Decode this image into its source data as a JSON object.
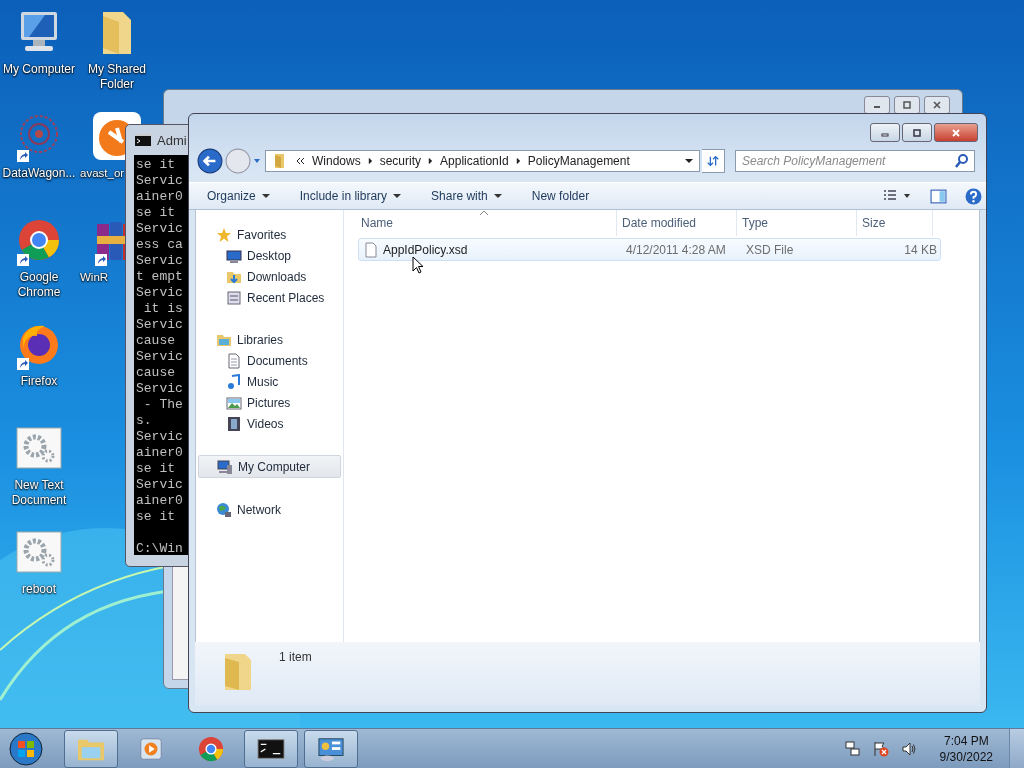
{
  "desktop": {
    "columns": [
      [
        {
          "label": "My Computer",
          "kind": "computer",
          "shortcut": false,
          "cut_off": false
        },
        {
          "label": "DataWagon...",
          "kind": "network",
          "shortcut": true,
          "cut_off": false
        },
        {
          "label": "Google Chrome",
          "kind": "chrome",
          "shortcut": true,
          "cut_off": false
        },
        {
          "label": "Firefox",
          "kind": "firefox",
          "shortcut": true,
          "cut_off": false
        },
        {
          "label": "New Text Document",
          "kind": "gears",
          "shortcut": false,
          "cut_off": false
        },
        {
          "label": "reboot",
          "kind": "gears",
          "shortcut": false,
          "cut_off": false
        }
      ],
      [
        {
          "label": "My Shared Folder",
          "kind": "folder",
          "shortcut": false,
          "cut_off": false
        },
        {
          "label": "avast_or",
          "kind": "avast",
          "shortcut": false,
          "cut_off": true
        },
        {
          "label": "WinR",
          "kind": "archive",
          "shortcut": true,
          "cut_off": true
        }
      ]
    ]
  },
  "console": {
    "title": "Admi",
    "lines": [
      "se it",
      "Servic",
      "ainer0",
      "se it",
      "Servic",
      "ess ca",
      "Servic",
      "t empt",
      "Servic",
      " it is",
      "Servic",
      "cause",
      "Servic",
      "cause",
      "Servic",
      " - The",
      "s.",
      "Servic",
      "ainer0",
      "se it",
      "Servic",
      "ainer0",
      "se it"
    ],
    "prompt": "C:\\Win"
  },
  "explorer": {
    "breadcrumb": [
      "Windows",
      "security",
      "ApplicationId",
      "PolicyManagement"
    ],
    "search": {
      "placeholder": "Search PolicyManagement"
    },
    "toolbar": [
      {
        "label": "Organize",
        "dropdown": true
      },
      {
        "label": "Include in library",
        "dropdown": true
      },
      {
        "label": "Share with",
        "dropdown": true
      },
      {
        "label": "New folder",
        "dropdown": false
      }
    ],
    "nav": [
      {
        "label": "Favorites",
        "kind": "star",
        "selected": false,
        "children": [
          {
            "label": "Desktop",
            "kind": "desktop",
            "selected": false
          },
          {
            "label": "Downloads",
            "kind": "downloads",
            "selected": false
          },
          {
            "label": "Recent Places",
            "kind": "recent",
            "selected": false
          }
        ]
      },
      {
        "label": "Libraries",
        "kind": "libraries",
        "selected": false,
        "children": [
          {
            "label": "Documents",
            "kind": "documents",
            "selected": false
          },
          {
            "label": "Music",
            "kind": "music",
            "selected": false
          },
          {
            "label": "Pictures",
            "kind": "pictures",
            "selected": false
          },
          {
            "label": "Videos",
            "kind": "videos",
            "selected": false
          }
        ]
      },
      {
        "label": "My Computer",
        "kind": "computer",
        "selected": true
      },
      {
        "label": "Network",
        "kind": "network",
        "selected": false
      }
    ],
    "columns": [
      "Name",
      "Date modified",
      "Type",
      "Size"
    ],
    "rows": [
      {
        "name": "AppIdPolicy.xsd",
        "date": "4/12/2011 4:28 AM",
        "type": "XSD File",
        "size": "14 KB",
        "highlighted": true
      }
    ],
    "status": "1 item"
  },
  "taskbar": {
    "items": [
      {
        "kind": "explorer",
        "running": true
      },
      {
        "kind": "media",
        "running": false
      },
      {
        "kind": "chrome",
        "running": false
      },
      {
        "kind": "console",
        "running": true
      },
      {
        "kind": "control",
        "running": true
      }
    ],
    "time": "7:04 PM",
    "date": "9/30/2022"
  }
}
